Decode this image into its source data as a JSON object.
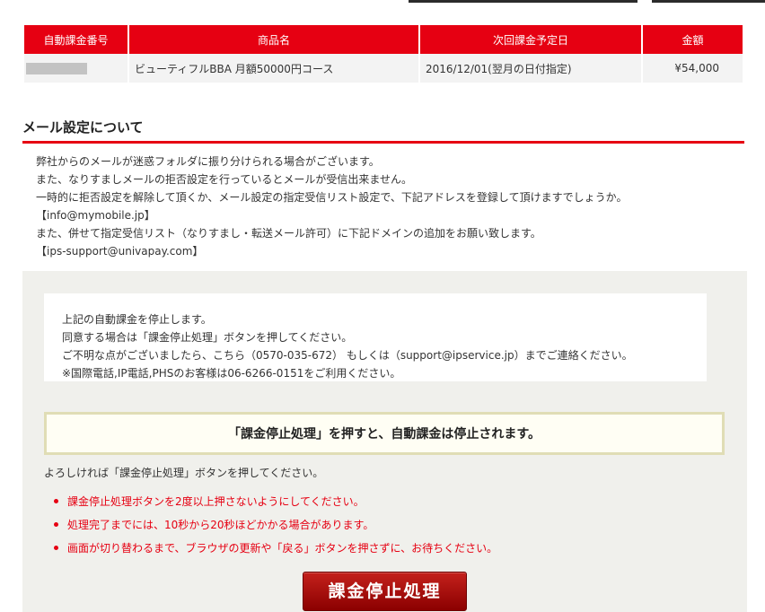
{
  "table": {
    "headers": [
      "自動課金番号",
      "商品名",
      "次回課金予定日",
      "金額"
    ],
    "row": {
      "product": "ビューティフルBBA 月額50000円コース",
      "next_date": "2016/12/01(翌月の日付指定)",
      "amount": "¥54,000"
    }
  },
  "mail": {
    "heading": "メール設定について",
    "lines": [
      "弊社からのメールが迷惑フォルダに振り分けられる場合がございます。",
      "また、なりすましメールの拒否設定を行っているとメールが受信出来ません。",
      "一時的に拒否設定を解除して頂くか、メール設定の指定受信リスト設定で、下記アドレスを登録して頂けますでしょうか。",
      "【info@mymobile.jp】",
      "また、併せて指定受信リスト（なりすまし・転送メール許可）に下記ドメインの追加をお願い致します。",
      "【ips-support@univapay.com】"
    ]
  },
  "notice": {
    "lines": [
      "上記の自動課金を停止します。",
      "同意する場合は「課金停止処理」ボタンを押してください。",
      "ご不明な点がございましたら、こちら（0570-035-672） もしくは（support@ipservice.jp）までご連絡ください。",
      "※国際電話,IP電話,PHSのお客様は06-6266-0151をご利用ください。"
    ]
  },
  "warning": "「課金停止処理」を押すと、自動課金は停止されます。",
  "prompt": "よろしければ「課金停止処理」ボタンを押してください。",
  "cautions": [
    "課金停止処理ボタンを2度以上押さないようにしてください。",
    "処理完了までには、10秒から20秒ほどかかる場合があります。",
    "画面が切り替わるまで、ブラウザの更新や「戻る」ボタンを押さずに、お待ちください。"
  ],
  "button": {
    "label": "課金停止処理"
  },
  "colors": {
    "accent": "#e60012",
    "button": "#a5100d",
    "panel": "#f0f0ec"
  }
}
